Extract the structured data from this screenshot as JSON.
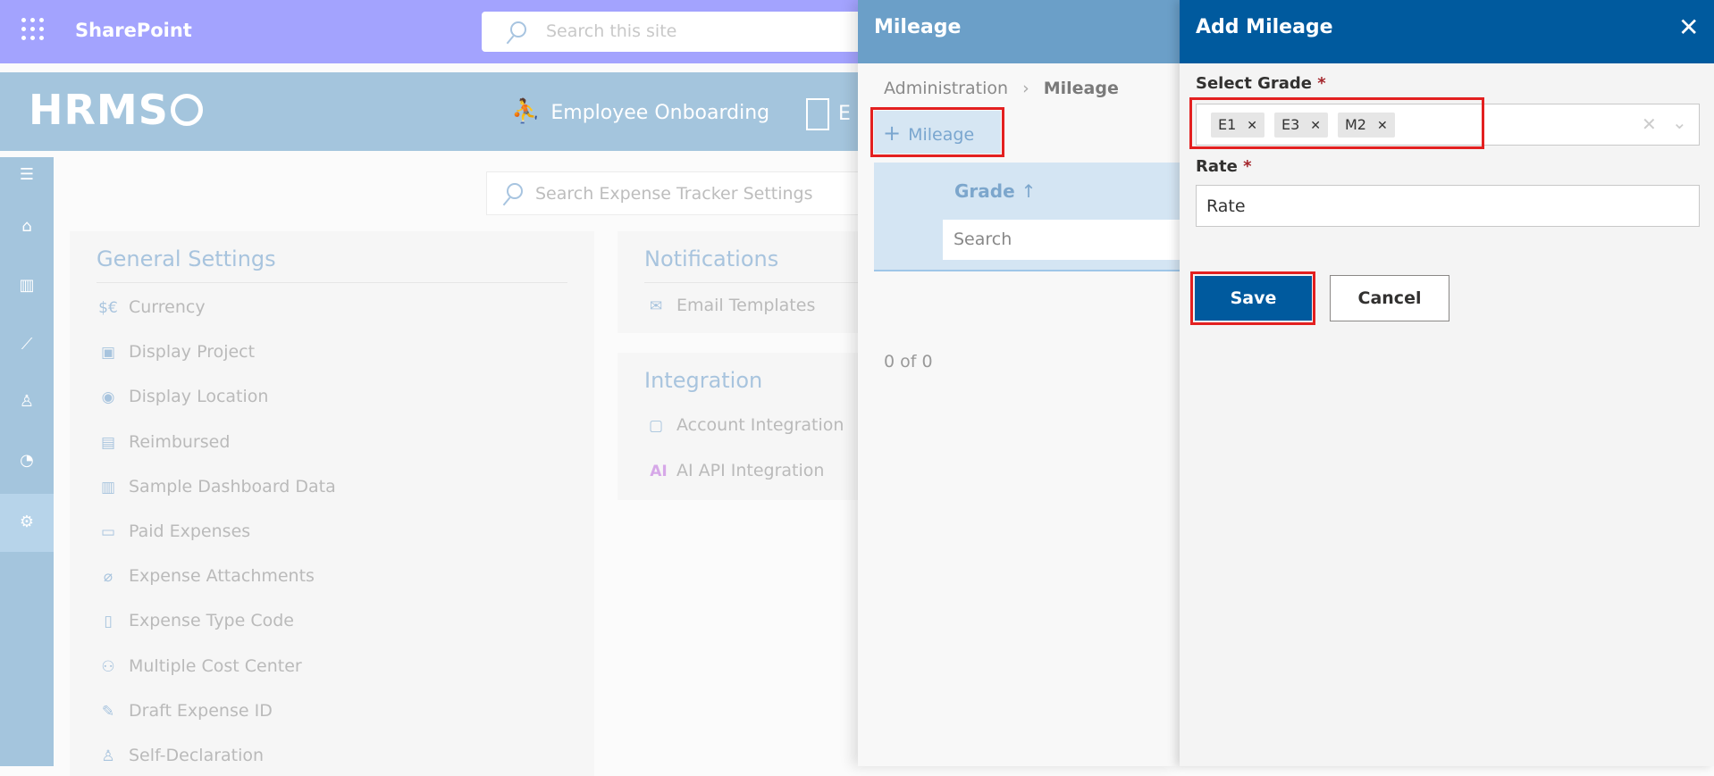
{
  "suite": {
    "app_name": "SharePoint",
    "search_placeholder": "Search this site"
  },
  "header": {
    "logo": "HRMS",
    "nav": [
      {
        "label": "Employee Onboarding",
        "icon": "onboarding-icon"
      },
      {
        "label": "E",
        "icon": "directory-icon"
      }
    ]
  },
  "sidebar": {
    "items": [
      {
        "icon": "hamburger-icon"
      },
      {
        "icon": "home-icon"
      },
      {
        "icon": "dashboard-icon"
      },
      {
        "icon": "chart-icon"
      },
      {
        "icon": "user-settings-icon"
      },
      {
        "icon": "palette-icon"
      },
      {
        "icon": "gear-icon",
        "active": true
      }
    ]
  },
  "settings": {
    "search_placeholder": "Search Expense Tracker Settings",
    "general": {
      "title": "General Settings",
      "items": [
        {
          "label": "Currency",
          "icon": "$€"
        },
        {
          "label": "Display Project",
          "icon": "▣"
        },
        {
          "label": "Display Location",
          "icon": "◉"
        },
        {
          "label": "Reimbursed",
          "icon": "▤"
        },
        {
          "label": "Sample Dashboard Data",
          "icon": "▥"
        },
        {
          "label": "Paid Expenses",
          "icon": "▭"
        },
        {
          "label": "Expense Attachments",
          "icon": "⌀"
        },
        {
          "label": "Expense Type Code",
          "icon": "▯"
        },
        {
          "label": "Multiple Cost Center",
          "icon": "⚇"
        },
        {
          "label": "Draft Expense ID",
          "icon": "✎"
        },
        {
          "label": "Self-Declaration",
          "icon": "♙"
        }
      ]
    },
    "notifications": {
      "title": "Notifications",
      "items": [
        {
          "label": "Email Templates",
          "icon": "✉"
        }
      ]
    },
    "integration": {
      "title": "Integration",
      "items": [
        {
          "label": "Account Integration",
          "icon": "▢"
        },
        {
          "label": "AI API Integration",
          "icon": "AI"
        }
      ]
    }
  },
  "mileage_panel": {
    "title": "Mileage",
    "breadcrumb": [
      "Administration",
      "Mileage"
    ],
    "add_label": "Mileage",
    "grid": {
      "column": "Grade",
      "sort": "↑",
      "search_placeholder": "Search"
    },
    "paging": "0 of 0"
  },
  "add_panel": {
    "title": "Add Mileage",
    "grade_label": "Select Grade",
    "required": "*",
    "selected_grades": [
      "E1",
      "E3",
      "M2"
    ],
    "rate_label": "Rate",
    "rate_placeholder": "Rate",
    "save": "Save",
    "cancel": "Cancel"
  },
  "colors": {
    "suite_bar": "#a3a3fe",
    "brand": "#005a9e",
    "highlight": "#e32020"
  }
}
